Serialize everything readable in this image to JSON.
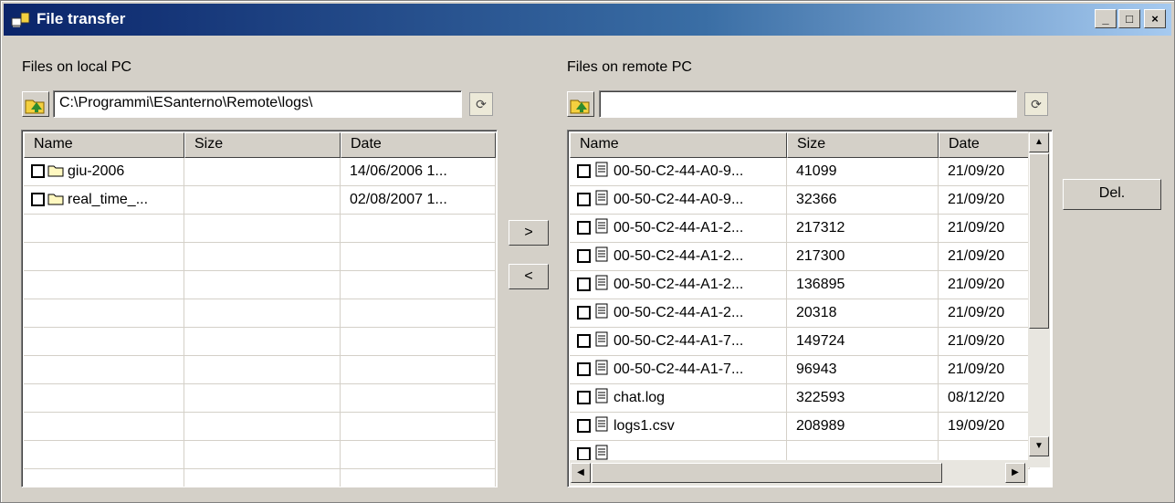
{
  "window": {
    "title": "File transfer",
    "minimize": "_",
    "maximize": "□",
    "close": "×"
  },
  "local": {
    "label": "Files on local PC",
    "path": "C:\\Programmi\\ESanterno\\Remote\\logs\\",
    "columns": [
      "Name",
      "Size",
      "Date"
    ],
    "rows": [
      {
        "name": "giu-2006",
        "size": "",
        "date": "14/06/2006 1...",
        "type": "folder"
      },
      {
        "name": "real_time_...",
        "size": "",
        "date": "02/08/2007 1...",
        "type": "folder"
      }
    ]
  },
  "remote": {
    "label": "Files on remote PC",
    "path": "",
    "columns": [
      "Name",
      "Size",
      "Date"
    ],
    "rows": [
      {
        "name": "00-50-C2-44-A0-9...",
        "size": "41099",
        "date": "21/09/20",
        "type": "file"
      },
      {
        "name": "00-50-C2-44-A0-9...",
        "size": "32366",
        "date": "21/09/20",
        "type": "file"
      },
      {
        "name": "00-50-C2-44-A1-2...",
        "size": "217312",
        "date": "21/09/20",
        "type": "file"
      },
      {
        "name": "00-50-C2-44-A1-2...",
        "size": "217300",
        "date": "21/09/20",
        "type": "file"
      },
      {
        "name": "00-50-C2-44-A1-2...",
        "size": "136895",
        "date": "21/09/20",
        "type": "file"
      },
      {
        "name": "00-50-C2-44-A1-2...",
        "size": "20318",
        "date": "21/09/20",
        "type": "file"
      },
      {
        "name": "00-50-C2-44-A1-7...",
        "size": "149724",
        "date": "21/09/20",
        "type": "file"
      },
      {
        "name": "00-50-C2-44-A1-7...",
        "size": "96943",
        "date": "21/09/20",
        "type": "file"
      },
      {
        "name": "chat.log",
        "size": "322593",
        "date": "08/12/20",
        "type": "file"
      },
      {
        "name": "logs1.csv",
        "size": "208989",
        "date": "19/09/20",
        "type": "file"
      },
      {
        "name": "",
        "size": "",
        "date": "",
        "type": "file"
      }
    ]
  },
  "buttons": {
    "to_remote": ">",
    "to_local": "<",
    "delete": "Del."
  }
}
